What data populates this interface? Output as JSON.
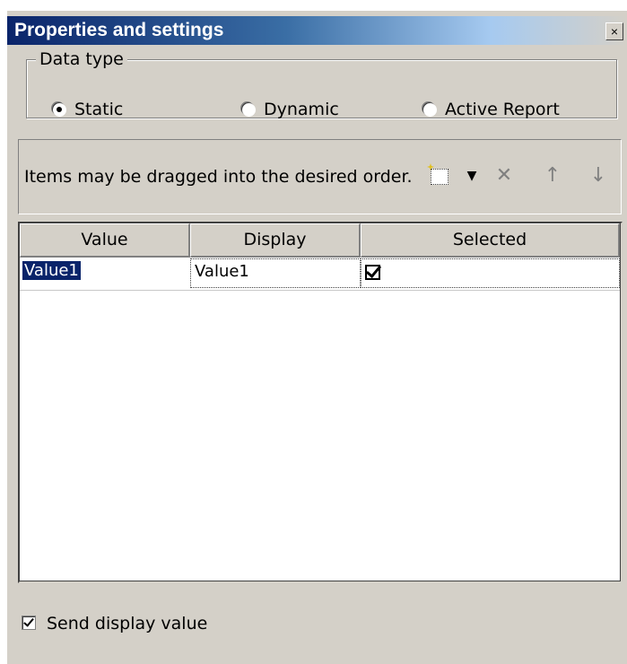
{
  "window": {
    "title": "Properties and settings",
    "close_glyph": "×"
  },
  "data_type": {
    "legend": "Data type",
    "options": [
      {
        "label": "Static",
        "checked": true
      },
      {
        "label": "Dynamic",
        "checked": false
      },
      {
        "label": "Active Report",
        "checked": false
      }
    ]
  },
  "toolbar": {
    "hint": "Items may be dragged into the desired order.",
    "icons": [
      "new-item-icon",
      "dropdown-arrow-icon",
      "delete-icon",
      "move-up-icon",
      "move-down-icon"
    ]
  },
  "grid": {
    "columns": [
      "Value",
      "Display",
      "Selected"
    ],
    "rows": [
      {
        "value": "Value1",
        "display": "Value1",
        "selected": true
      }
    ]
  },
  "send_display_value": {
    "label": "Send display value",
    "checked": true
  },
  "colors": {
    "titlebar_start": "#0a246a",
    "titlebar_end": "#a6caf0",
    "face": "#d4d0c8",
    "selection": "#0a246a"
  }
}
